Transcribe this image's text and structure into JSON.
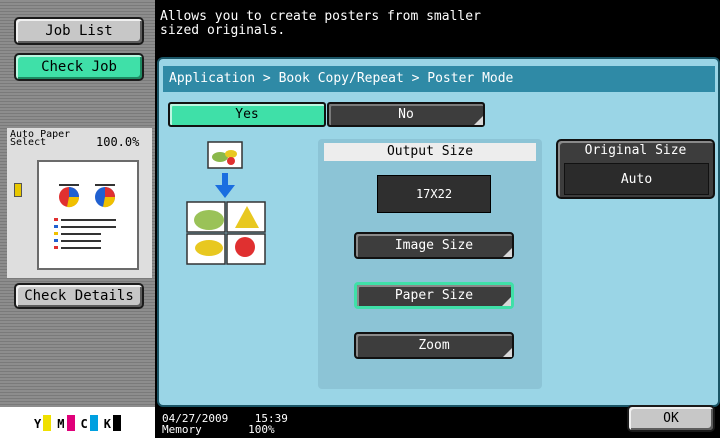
{
  "sidebar": {
    "job_list": "Job List",
    "check_job": "Check Job",
    "preview_paper_line1": "Auto Paper",
    "preview_paper_line2": "Select",
    "preview_zoom": "100.0%",
    "check_details": "Check Details"
  },
  "toner": [
    {
      "label": "Y",
      "color": "#f0e000"
    },
    {
      "label": "M",
      "color": "#e0007a"
    },
    {
      "label": "C",
      "color": "#00a0e0"
    },
    {
      "label": "K",
      "color": "#000000"
    }
  ],
  "message": "Allows you to create posters from smaller\nsized originals.",
  "breadcrumb": "Application > Book Copy/Repeat > Poster Mode",
  "toggle": {
    "yes": "Yes",
    "no": "No"
  },
  "output": {
    "label": "Output Size",
    "value": "17X22",
    "image_size": "Image Size",
    "paper_size": "Paper Size",
    "zoom": "Zoom"
  },
  "original": {
    "label": "Original Size",
    "value": "Auto"
  },
  "status": {
    "date": "04/27/2009",
    "time": "15:39",
    "memory_label": "Memory",
    "memory_value": "100%"
  },
  "ok": "OK"
}
